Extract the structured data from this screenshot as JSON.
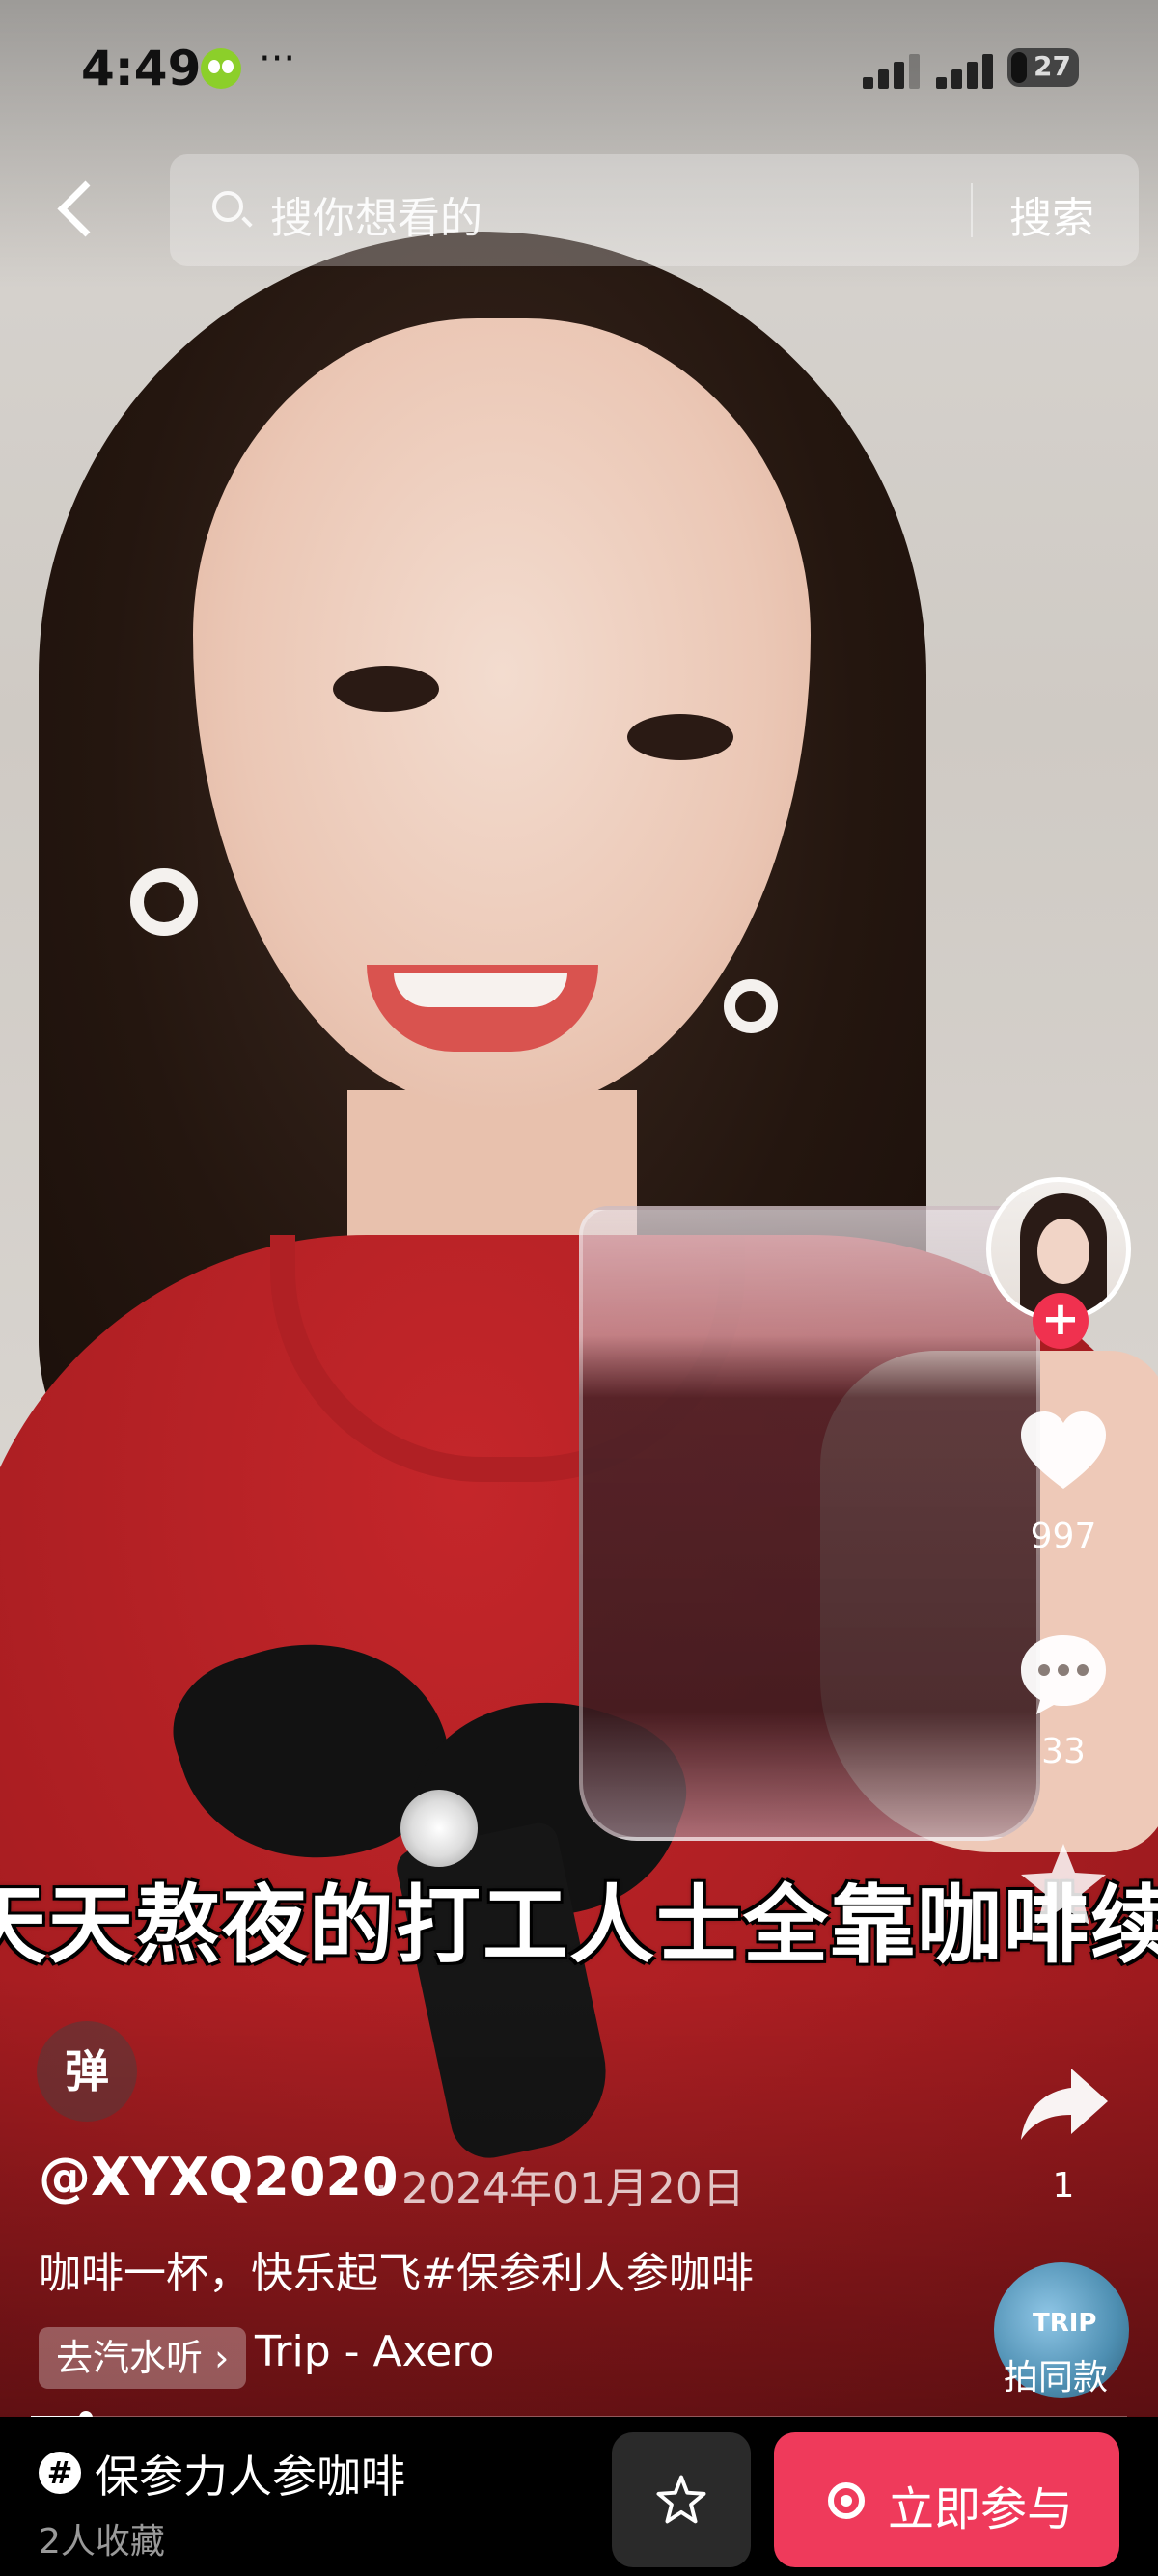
{
  "status_bar": {
    "time": "4:49",
    "more": "···",
    "battery": "27"
  },
  "header": {
    "search_placeholder": "搜你想看的",
    "search_button": "搜索"
  },
  "video": {
    "caption_overlay": "天天熬夜的打工人士全靠咖啡续命",
    "progress": 0.05
  },
  "side_rail": {
    "follow": "+",
    "likes": "997",
    "comments": "33",
    "shares": "1",
    "music_disc_text": "TRIP",
    "same_style_label": "拍同款"
  },
  "post": {
    "danmu": "弹",
    "username": "@XYXQ2020",
    "date": "· 2024年01月20日",
    "description": "咖啡一杯，快乐起飞#保参利人参咖啡",
    "music_chip": "去汽水听 ›",
    "music_title": "Trip - Axero"
  },
  "bottom_bar": {
    "topic_icon": "#",
    "topic_title": "保参力人参咖啡",
    "topic_sub": "2人收藏",
    "join_label": "立即参与"
  },
  "colors": {
    "accent": "#ef3a5b",
    "follow": "#f0314f"
  }
}
